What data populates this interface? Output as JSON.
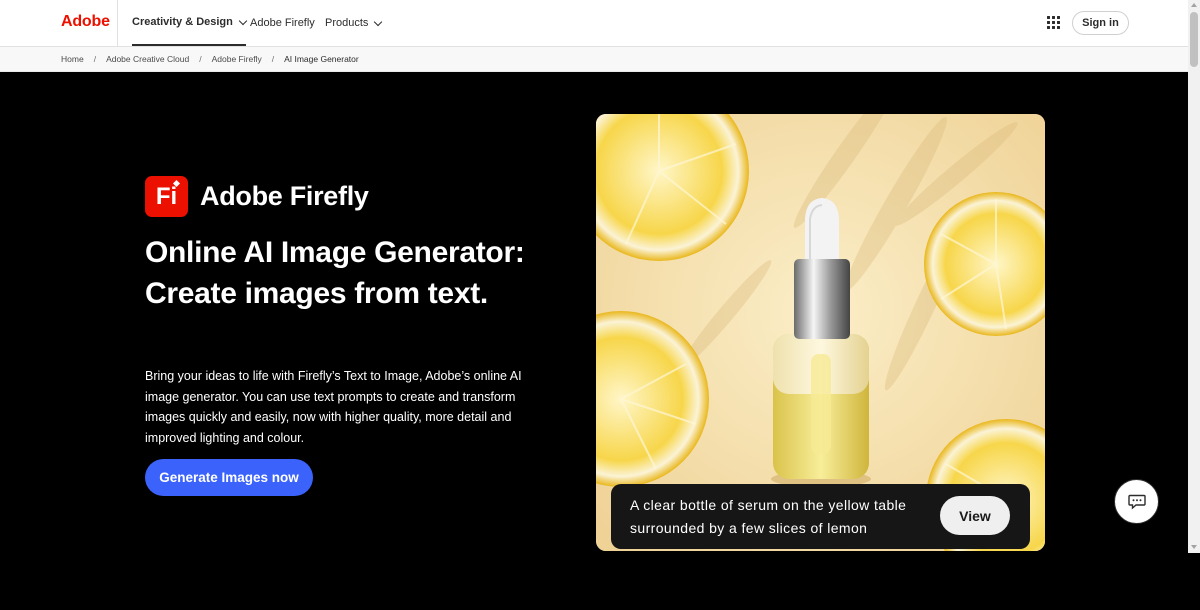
{
  "nav": {
    "logo": "Adobe",
    "items": [
      {
        "label": "Creativity & Design"
      },
      {
        "label": "Adobe Firefly"
      },
      {
        "label": "Products"
      }
    ],
    "signin": "Sign in"
  },
  "breadcrumb": [
    "Home",
    "Adobe Creative Cloud",
    "Adobe Firefly",
    "AI Image Generator"
  ],
  "breadcrumb_separator": "/",
  "hero": {
    "logo_text": "Fi",
    "brand": "Adobe Firefly",
    "headline": "Online AI Image Generator: Create images from text.",
    "description": "Bring your ideas to life with Firefly’s Text to Image, Adobe’s online AI image generator. You can use text prompts to create and transform images quickly and easily, now with higher quality, more detail and improved lighting and colour.",
    "cta": "Generate Images now"
  },
  "showcase": {
    "caption": "A clear bottle of serum on the yellow table surrounded by a few slices of lemon",
    "view": "View"
  },
  "colors": {
    "adobe_red": "#eb1000",
    "cta_blue": "#3b63fb",
    "hero_bg": "#000000"
  },
  "icons": [
    "apps-grid-icon",
    "chat-icon",
    "chevron-down-icon"
  ]
}
